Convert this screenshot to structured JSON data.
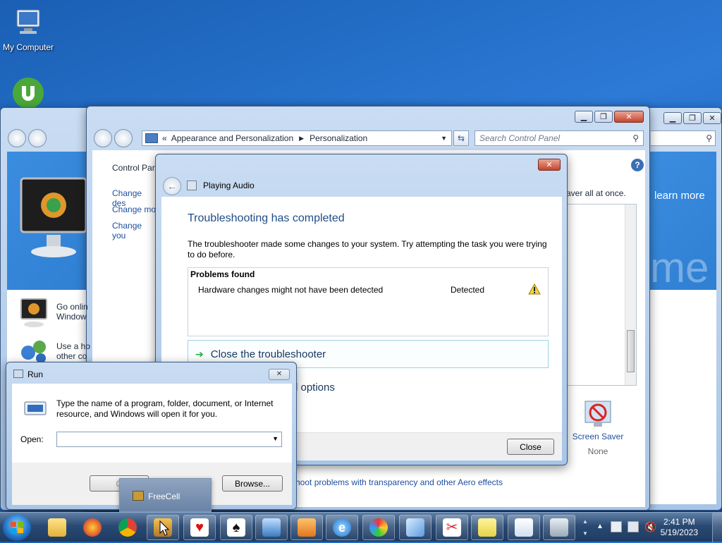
{
  "desktop": {
    "icons": [
      {
        "label": "My Computer",
        "icon": "my-computer-icon"
      },
      {
        "label": "",
        "icon": "utorrent-icon"
      }
    ]
  },
  "back_window": {
    "learn_more": "learn more",
    "big_text": "me"
  },
  "cp_window": {
    "address": {
      "separator": "«",
      "crumbs": [
        "Appearance and Personalization",
        "Personalization"
      ]
    },
    "search_placeholder": "Search Control Panel",
    "left_pane": {
      "home": "Control Pan",
      "links": [
        "Change des",
        "Change mo",
        "Change you"
      ]
    },
    "right_fragment": "aver all at once.",
    "online_item": {
      "line1": "Go onlin",
      "line2": "Window"
    },
    "other_item": {
      "line1": "Use a ho",
      "line2": "other co"
    },
    "screen_saver": {
      "label": "Screen Saver",
      "value": "None"
    },
    "aero_link": "hoot problems with transparency and other Aero effects"
  },
  "troubleshooter": {
    "window_title": "Playing Audio",
    "heading": "Troubleshooting has completed",
    "description": "The troubleshooter made some changes to your system. Try attempting the task you were trying to do before.",
    "problems_header": "Problems found",
    "problems": [
      {
        "name": "Hardware changes might not have been detected",
        "status": "Detected",
        "icon": "warning-icon"
      }
    ],
    "close_link": "Close the troubleshooter",
    "options_fragment": "l options",
    "close_button": "Close"
  },
  "run_dialog": {
    "title": "Run",
    "description": "Type the name of a program, folder, document, or Internet resource, and Windows will open it for you.",
    "open_label": "Open:",
    "open_value": "",
    "ok_label": "O",
    "browse_label": "Browse..."
  },
  "tooltip": {
    "label": "FreeCell"
  },
  "taskbar": {
    "items": [
      {
        "name": "start-orb",
        "icon": "windows-orb-icon"
      },
      {
        "name": "explorer",
        "icon": "folder-icon"
      },
      {
        "name": "firefox",
        "icon": "firefox-icon"
      },
      {
        "name": "chrome",
        "icon": "chrome-icon"
      },
      {
        "name": "freecell",
        "icon": "freecell-icon"
      },
      {
        "name": "hearts",
        "icon": "hearts-icon"
      },
      {
        "name": "solitaire",
        "icon": "solitaire-icon"
      },
      {
        "name": "remote-desktop",
        "icon": "remote-desktop-icon"
      },
      {
        "name": "media-player",
        "icon": "media-player-icon"
      },
      {
        "name": "internet-explorer",
        "icon": "ie-icon"
      },
      {
        "name": "paint",
        "icon": "paint-icon"
      },
      {
        "name": "send",
        "icon": "paper-plane-icon"
      },
      {
        "name": "snipping-tool",
        "icon": "scissors-icon"
      },
      {
        "name": "sticky-notes",
        "icon": "sticky-notes-icon"
      },
      {
        "name": "notepad",
        "icon": "document-icon"
      },
      {
        "name": "control-panel",
        "icon": "control-panel-icon"
      }
    ],
    "clock": {
      "time": "2:41 PM",
      "date": "5/19/2023"
    }
  },
  "colors": {
    "link": "#1e4e9e",
    "heading": "#1f4d86",
    "close_red": "#c5442c"
  }
}
